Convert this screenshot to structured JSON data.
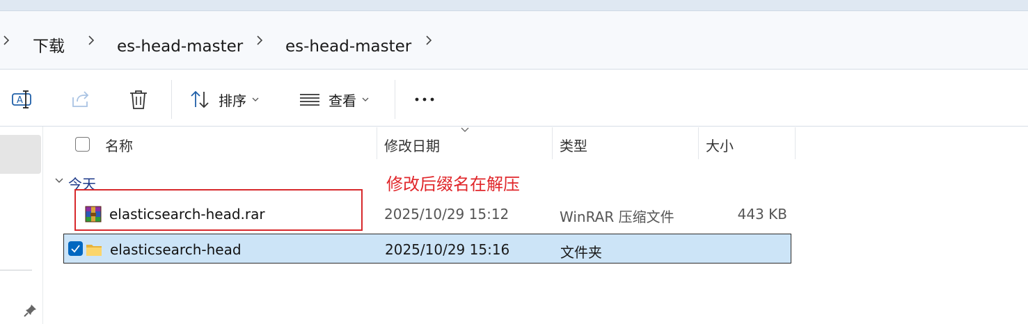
{
  "breadcrumb": {
    "items": [
      "下载",
      "es-head-master",
      "es-head-master"
    ]
  },
  "toolbar": {
    "rename_icon": "rename-icon",
    "share_icon": "share-icon",
    "delete_icon": "trash-icon",
    "sort_label": "排序",
    "view_label": "查看",
    "more_icon": "more-icon"
  },
  "list": {
    "columns": {
      "name": "名称",
      "date": "修改日期",
      "type": "类型",
      "size": "大小"
    },
    "group_label": "今天",
    "rows": [
      {
        "name": "elasticsearch-head.rar",
        "date": "2025/10/29 15:12",
        "type": "WinRAR 压缩文件",
        "size": "443 KB",
        "icon": "winrar-archive-icon"
      },
      {
        "name": "elasticsearch-head",
        "date": "2025/10/29 15:16",
        "type": "文件夹",
        "size": "",
        "icon": "folder-icon"
      }
    ]
  },
  "annotation": {
    "text": "修改后缀名在解压",
    "color": "#e0262a"
  },
  "colors": {
    "selection": "#cce4f7",
    "accent": "#0067c0"
  }
}
